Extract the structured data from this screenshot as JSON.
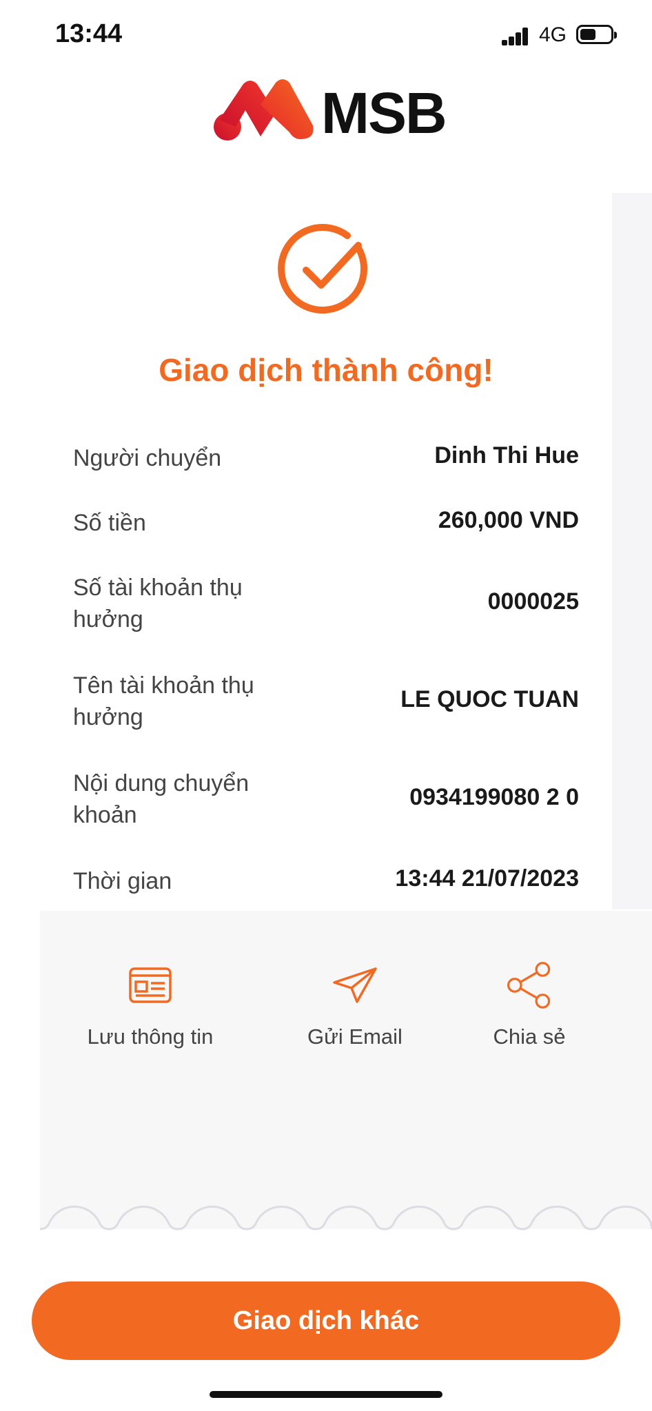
{
  "status_bar": {
    "time": "13:44",
    "network": "4G"
  },
  "brand": {
    "name": "MSB",
    "accent": "#f26a21"
  },
  "result": {
    "title": "Giao dịch thành công!"
  },
  "details": [
    {
      "label": "Người chuyển",
      "value": "Dinh Thi Hue"
    },
    {
      "label": "Số tiền",
      "value": "260,000 VND"
    },
    {
      "label": "Số tài khoản thụ hưởng",
      "value": "0000025"
    },
    {
      "label": "Tên tài khoản thụ hưởng",
      "value": "LE QUOC TUAN"
    },
    {
      "label": "Nội dung chuyển khoản",
      "value": "0934199080 2 0"
    },
    {
      "label": "Thời gian",
      "value": "13:44 21/07/2023"
    }
  ],
  "actions": [
    {
      "label": "Lưu thông tin",
      "icon": "save-card-icon"
    },
    {
      "label": "Gửi Email",
      "icon": "paper-plane-icon"
    },
    {
      "label": "Chia sẻ",
      "icon": "share-icon"
    }
  ],
  "primary_button": {
    "label": "Giao dịch khác"
  }
}
